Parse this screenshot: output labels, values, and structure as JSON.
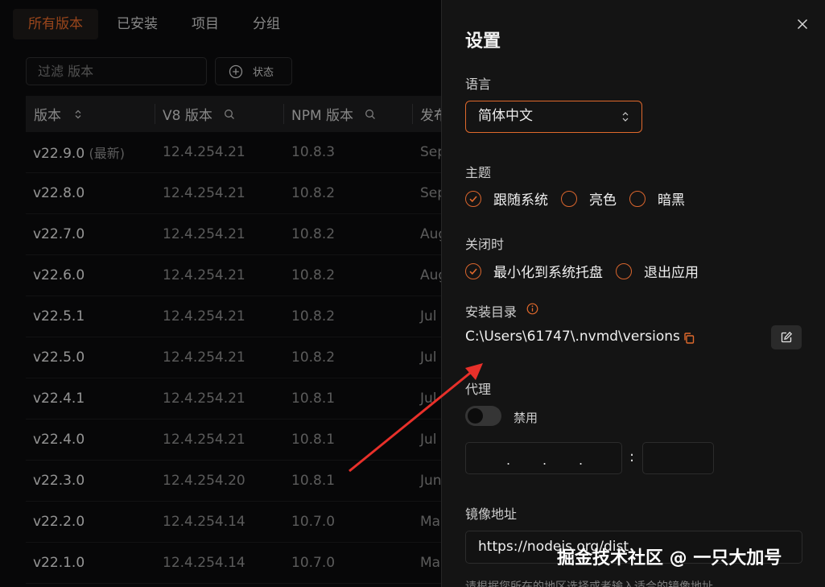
{
  "tabs": [
    "所有版本",
    "已安装",
    "项目",
    "分组"
  ],
  "filter": {
    "placeholder": "过滤 版本"
  },
  "status_button": {
    "label": "状态"
  },
  "table": {
    "headers": [
      "版本",
      "V8 版本",
      "NPM 版本",
      "发布"
    ],
    "latest_tag": "(最新)",
    "rows": [
      {
        "version": "v22.9.0",
        "v8": "12.4.254.21",
        "npm": "10.8.3",
        "date": "Sep"
      },
      {
        "version": "v22.8.0",
        "v8": "12.4.254.21",
        "npm": "10.8.2",
        "date": "Sep"
      },
      {
        "version": "v22.7.0",
        "v8": "12.4.254.21",
        "npm": "10.8.2",
        "date": "Aug"
      },
      {
        "version": "v22.6.0",
        "v8": "12.4.254.21",
        "npm": "10.8.2",
        "date": "Aug"
      },
      {
        "version": "v22.5.1",
        "v8": "12.4.254.21",
        "npm": "10.8.2",
        "date": "Jul"
      },
      {
        "version": "v22.5.0",
        "v8": "12.4.254.21",
        "npm": "10.8.2",
        "date": "Jul"
      },
      {
        "version": "v22.4.1",
        "v8": "12.4.254.21",
        "npm": "10.8.1",
        "date": "Jul"
      },
      {
        "version": "v22.4.0",
        "v8": "12.4.254.21",
        "npm": "10.8.1",
        "date": "Jul"
      },
      {
        "version": "v22.3.0",
        "v8": "12.4.254.20",
        "npm": "10.8.1",
        "date": "Jun"
      },
      {
        "version": "v22.2.0",
        "v8": "12.4.254.14",
        "npm": "10.7.0",
        "date": "Ma"
      },
      {
        "version": "v22.1.0",
        "v8": "12.4.254.14",
        "npm": "10.7.0",
        "date": "Ma"
      }
    ]
  },
  "settings": {
    "title": "设置",
    "language": {
      "label": "语言",
      "value": "简体中文"
    },
    "theme": {
      "label": "主题",
      "options": [
        "跟随系统",
        "亮色",
        "暗黑"
      ],
      "selected": 0
    },
    "on_close": {
      "label": "关闭时",
      "options": [
        "最小化到系统托盘",
        "退出应用"
      ],
      "selected": 0
    },
    "install_dir": {
      "label": "安装目录",
      "path": "C:\\Users\\61747\\.nvmd\\versions"
    },
    "proxy": {
      "label": "代理",
      "toggle_label": "禁用",
      "enabled": false,
      "separator": ":"
    },
    "mirror": {
      "label": "镜像地址",
      "value": "https://nodejs.org/dist",
      "hint": "请根据您所在的地区选择或者输入适合的镜像地址"
    }
  },
  "watermark": "掘金技术社区 @ 一只大加号",
  "colors": {
    "accent": "#e0692c",
    "background": "#141414"
  }
}
